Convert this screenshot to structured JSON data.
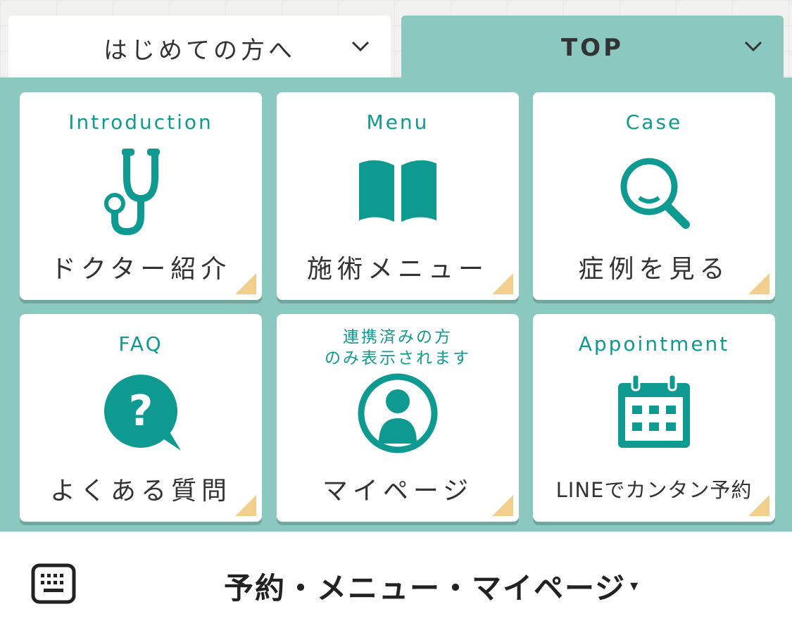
{
  "tabs": [
    {
      "label": "はじめての方へ",
      "active": false
    },
    {
      "label": "TOP",
      "active": true
    }
  ],
  "cards": [
    {
      "en": "Introduction",
      "jp": "ドクター紹介",
      "icon": "stethoscope-icon"
    },
    {
      "en": "Menu",
      "jp": "施術メニュー",
      "icon": "book-icon"
    },
    {
      "en": "Case",
      "jp": "症例を見る",
      "icon": "magnifier-icon"
    },
    {
      "en": "FAQ",
      "jp": "よくある質問",
      "icon": "question-bubble-icon"
    },
    {
      "en_line1": "連携済みの方",
      "en_line2": "のみ表示されます",
      "jp": "マイページ",
      "icon": "user-circle-icon"
    },
    {
      "en": "Appointment",
      "jp": "LINEでカンタン予約",
      "icon": "calendar-icon"
    }
  ],
  "bottom": {
    "menu_title": "予約・メニュー・マイページ",
    "toggle": "▾",
    "keyboard_icon": "keyboard-icon"
  },
  "colors": {
    "panel": "#8bc8bf",
    "accent": "#0f9a91",
    "corner": "#f2cf8c"
  }
}
